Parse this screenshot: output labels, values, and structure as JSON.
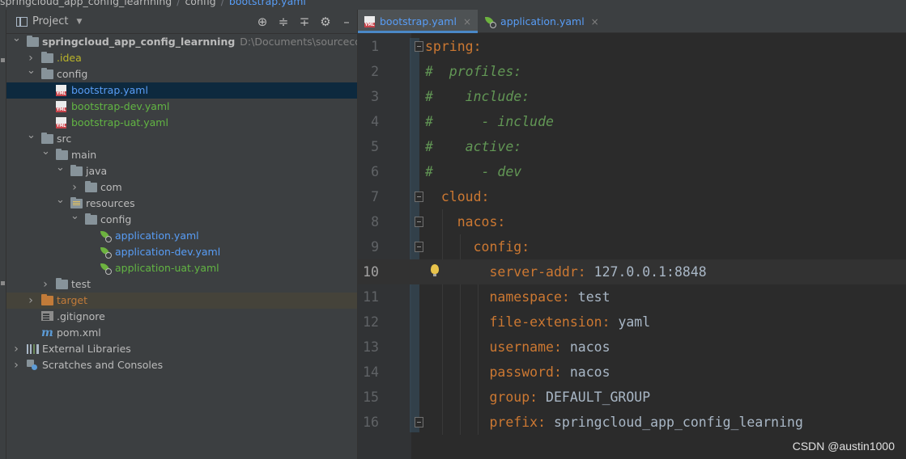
{
  "breadcrumb": {
    "items": [
      "springcloud_app_config_learnning",
      "config",
      "bootstrap.yaml"
    ]
  },
  "project_pane": {
    "title": "Project",
    "tools": [
      "locate-icon",
      "expand-all-icon",
      "collapse-all-icon",
      "gear-icon",
      "minimize-icon"
    ],
    "tree": [
      {
        "label": "springcloud_app_config_learnning",
        "extra": "D:\\Documents\\sourcecode\\git",
        "depth": 0,
        "icon": "module-folder-icon",
        "arrow": "down",
        "color": "default",
        "bold": true
      },
      {
        "label": ".idea",
        "depth": 1,
        "icon": "folder-icon",
        "arrow": "right",
        "color": "yellow"
      },
      {
        "label": "config",
        "depth": 1,
        "icon": "folder-icon",
        "arrow": "down",
        "color": "default"
      },
      {
        "label": "bootstrap.yaml",
        "depth": 2,
        "icon": "yaml-file-icon",
        "arrow": "",
        "color": "blue",
        "selected": true
      },
      {
        "label": "bootstrap-dev.yaml",
        "depth": 2,
        "icon": "yaml-file-icon",
        "arrow": "",
        "color": "green"
      },
      {
        "label": "bootstrap-uat.yaml",
        "depth": 2,
        "icon": "yaml-file-icon",
        "arrow": "",
        "color": "green"
      },
      {
        "label": "src",
        "depth": 1,
        "icon": "folder-icon",
        "arrow": "down",
        "color": "default"
      },
      {
        "label": "main",
        "depth": 2,
        "icon": "folder-icon",
        "arrow": "down",
        "color": "default"
      },
      {
        "label": "java",
        "depth": 3,
        "icon": "source-folder-icon",
        "arrow": "down",
        "color": "default"
      },
      {
        "label": "com",
        "depth": 4,
        "icon": "package-folder-icon",
        "arrow": "right",
        "color": "default"
      },
      {
        "label": "resources",
        "depth": 3,
        "icon": "resources-folder-icon",
        "arrow": "down",
        "color": "default"
      },
      {
        "label": "config",
        "depth": 4,
        "icon": "folder-icon",
        "arrow": "down",
        "color": "default"
      },
      {
        "label": "application.yaml",
        "depth": 5,
        "icon": "spring-yaml-icon",
        "arrow": "",
        "color": "blue"
      },
      {
        "label": "application-dev.yaml",
        "depth": 5,
        "icon": "spring-yaml-icon",
        "arrow": "",
        "color": "blue"
      },
      {
        "label": "application-uat.yaml",
        "depth": 5,
        "icon": "spring-yaml-icon",
        "arrow": "",
        "color": "green"
      },
      {
        "label": "test",
        "depth": 2,
        "icon": "folder-icon",
        "arrow": "right",
        "color": "default"
      },
      {
        "label": "target",
        "depth": 1,
        "icon": "excluded-folder-icon",
        "arrow": "right",
        "color": "orange",
        "target": true
      },
      {
        "label": ".gitignore",
        "depth": 1,
        "icon": "gitignore-file-icon",
        "arrow": "",
        "color": "default"
      },
      {
        "label": "pom.xml",
        "depth": 1,
        "icon": "maven-file-icon",
        "arrow": "",
        "color": "default"
      },
      {
        "label": "External Libraries",
        "depth": 0,
        "icon": "libraries-icon",
        "arrow": "right",
        "color": "default"
      },
      {
        "label": "Scratches and Consoles",
        "depth": 0,
        "icon": "scratches-icon",
        "arrow": "right",
        "color": "default"
      }
    ]
  },
  "editor": {
    "tabs": [
      {
        "label": "bootstrap.yaml",
        "icon": "yaml-file-icon",
        "active": true
      },
      {
        "label": "application.yaml",
        "icon": "spring-yaml-icon",
        "active": false
      }
    ],
    "current_line": 10,
    "lines": [
      {
        "n": "1",
        "fold": true,
        "parts": [
          {
            "t": "spring",
            "c": "k"
          },
          {
            "t": ":",
            "c": "p"
          }
        ]
      },
      {
        "n": "2",
        "fold": false,
        "parts": [
          {
            "t": "#  profiles:",
            "c": "c"
          }
        ]
      },
      {
        "n": "3",
        "fold": false,
        "parts": [
          {
            "t": "#    include:",
            "c": "c"
          }
        ]
      },
      {
        "n": "4",
        "fold": false,
        "parts": [
          {
            "t": "#      - include",
            "c": "c"
          }
        ]
      },
      {
        "n": "5",
        "fold": false,
        "parts": [
          {
            "t": "#    active:",
            "c": "c"
          }
        ]
      },
      {
        "n": "6",
        "fold": false,
        "parts": [
          {
            "t": "#      - dev",
            "c": "c"
          }
        ]
      },
      {
        "n": "7",
        "fold": true,
        "parts": [
          {
            "t": "  ",
            "c": "v"
          },
          {
            "t": "cloud",
            "c": "k"
          },
          {
            "t": ":",
            "c": "p"
          }
        ]
      },
      {
        "n": "8",
        "fold": true,
        "parts": [
          {
            "t": "    ",
            "c": "v"
          },
          {
            "t": "nacos",
            "c": "k"
          },
          {
            "t": ":",
            "c": "p"
          }
        ]
      },
      {
        "n": "9",
        "fold": true,
        "parts": [
          {
            "t": "      ",
            "c": "v"
          },
          {
            "t": "config",
            "c": "k"
          },
          {
            "t": ":",
            "c": "p"
          }
        ]
      },
      {
        "n": "10",
        "fold": false,
        "bulb": true,
        "parts": [
          {
            "t": "        ",
            "c": "v"
          },
          {
            "t": "server-addr",
            "c": "k"
          },
          {
            "t": ": ",
            "c": "p"
          },
          {
            "t": "127.0.0.1:8848",
            "c": "v"
          }
        ]
      },
      {
        "n": "11",
        "fold": false,
        "parts": [
          {
            "t": "        ",
            "c": "v"
          },
          {
            "t": "namespace",
            "c": "k"
          },
          {
            "t": ": ",
            "c": "p"
          },
          {
            "t": "test",
            "c": "v"
          }
        ]
      },
      {
        "n": "12",
        "fold": false,
        "parts": [
          {
            "t": "        ",
            "c": "v"
          },
          {
            "t": "file-extension",
            "c": "k"
          },
          {
            "t": ": ",
            "c": "p"
          },
          {
            "t": "yaml",
            "c": "v"
          }
        ]
      },
      {
        "n": "13",
        "fold": false,
        "parts": [
          {
            "t": "        ",
            "c": "v"
          },
          {
            "t": "username",
            "c": "k"
          },
          {
            "t": ": ",
            "c": "p"
          },
          {
            "t": "nacos",
            "c": "v"
          }
        ]
      },
      {
        "n": "14",
        "fold": false,
        "parts": [
          {
            "t": "        ",
            "c": "v"
          },
          {
            "t": "password",
            "c": "k"
          },
          {
            "t": ": ",
            "c": "p"
          },
          {
            "t": "nacos",
            "c": "v"
          }
        ]
      },
      {
        "n": "15",
        "fold": false,
        "parts": [
          {
            "t": "        ",
            "c": "v"
          },
          {
            "t": "group",
            "c": "k"
          },
          {
            "t": ": ",
            "c": "p"
          },
          {
            "t": "DEFAULT_GROUP",
            "c": "v"
          }
        ]
      },
      {
        "n": "16",
        "fold": true,
        "parts": [
          {
            "t": "        ",
            "c": "v"
          },
          {
            "t": "prefix",
            "c": "k"
          },
          {
            "t": ": ",
            "c": "p"
          },
          {
            "t": "springcloud_app_config_learning",
            "c": "v"
          }
        ]
      }
    ]
  },
  "watermark": "CSDN @austin1000",
  "colors": {
    "background": "#2b2b2b",
    "panel": "#3c3f41",
    "key": "#cc7832",
    "comment": "#629755",
    "value": "#a9b7c6",
    "selected_row": "#0d293e",
    "link_blue": "#589df6"
  }
}
